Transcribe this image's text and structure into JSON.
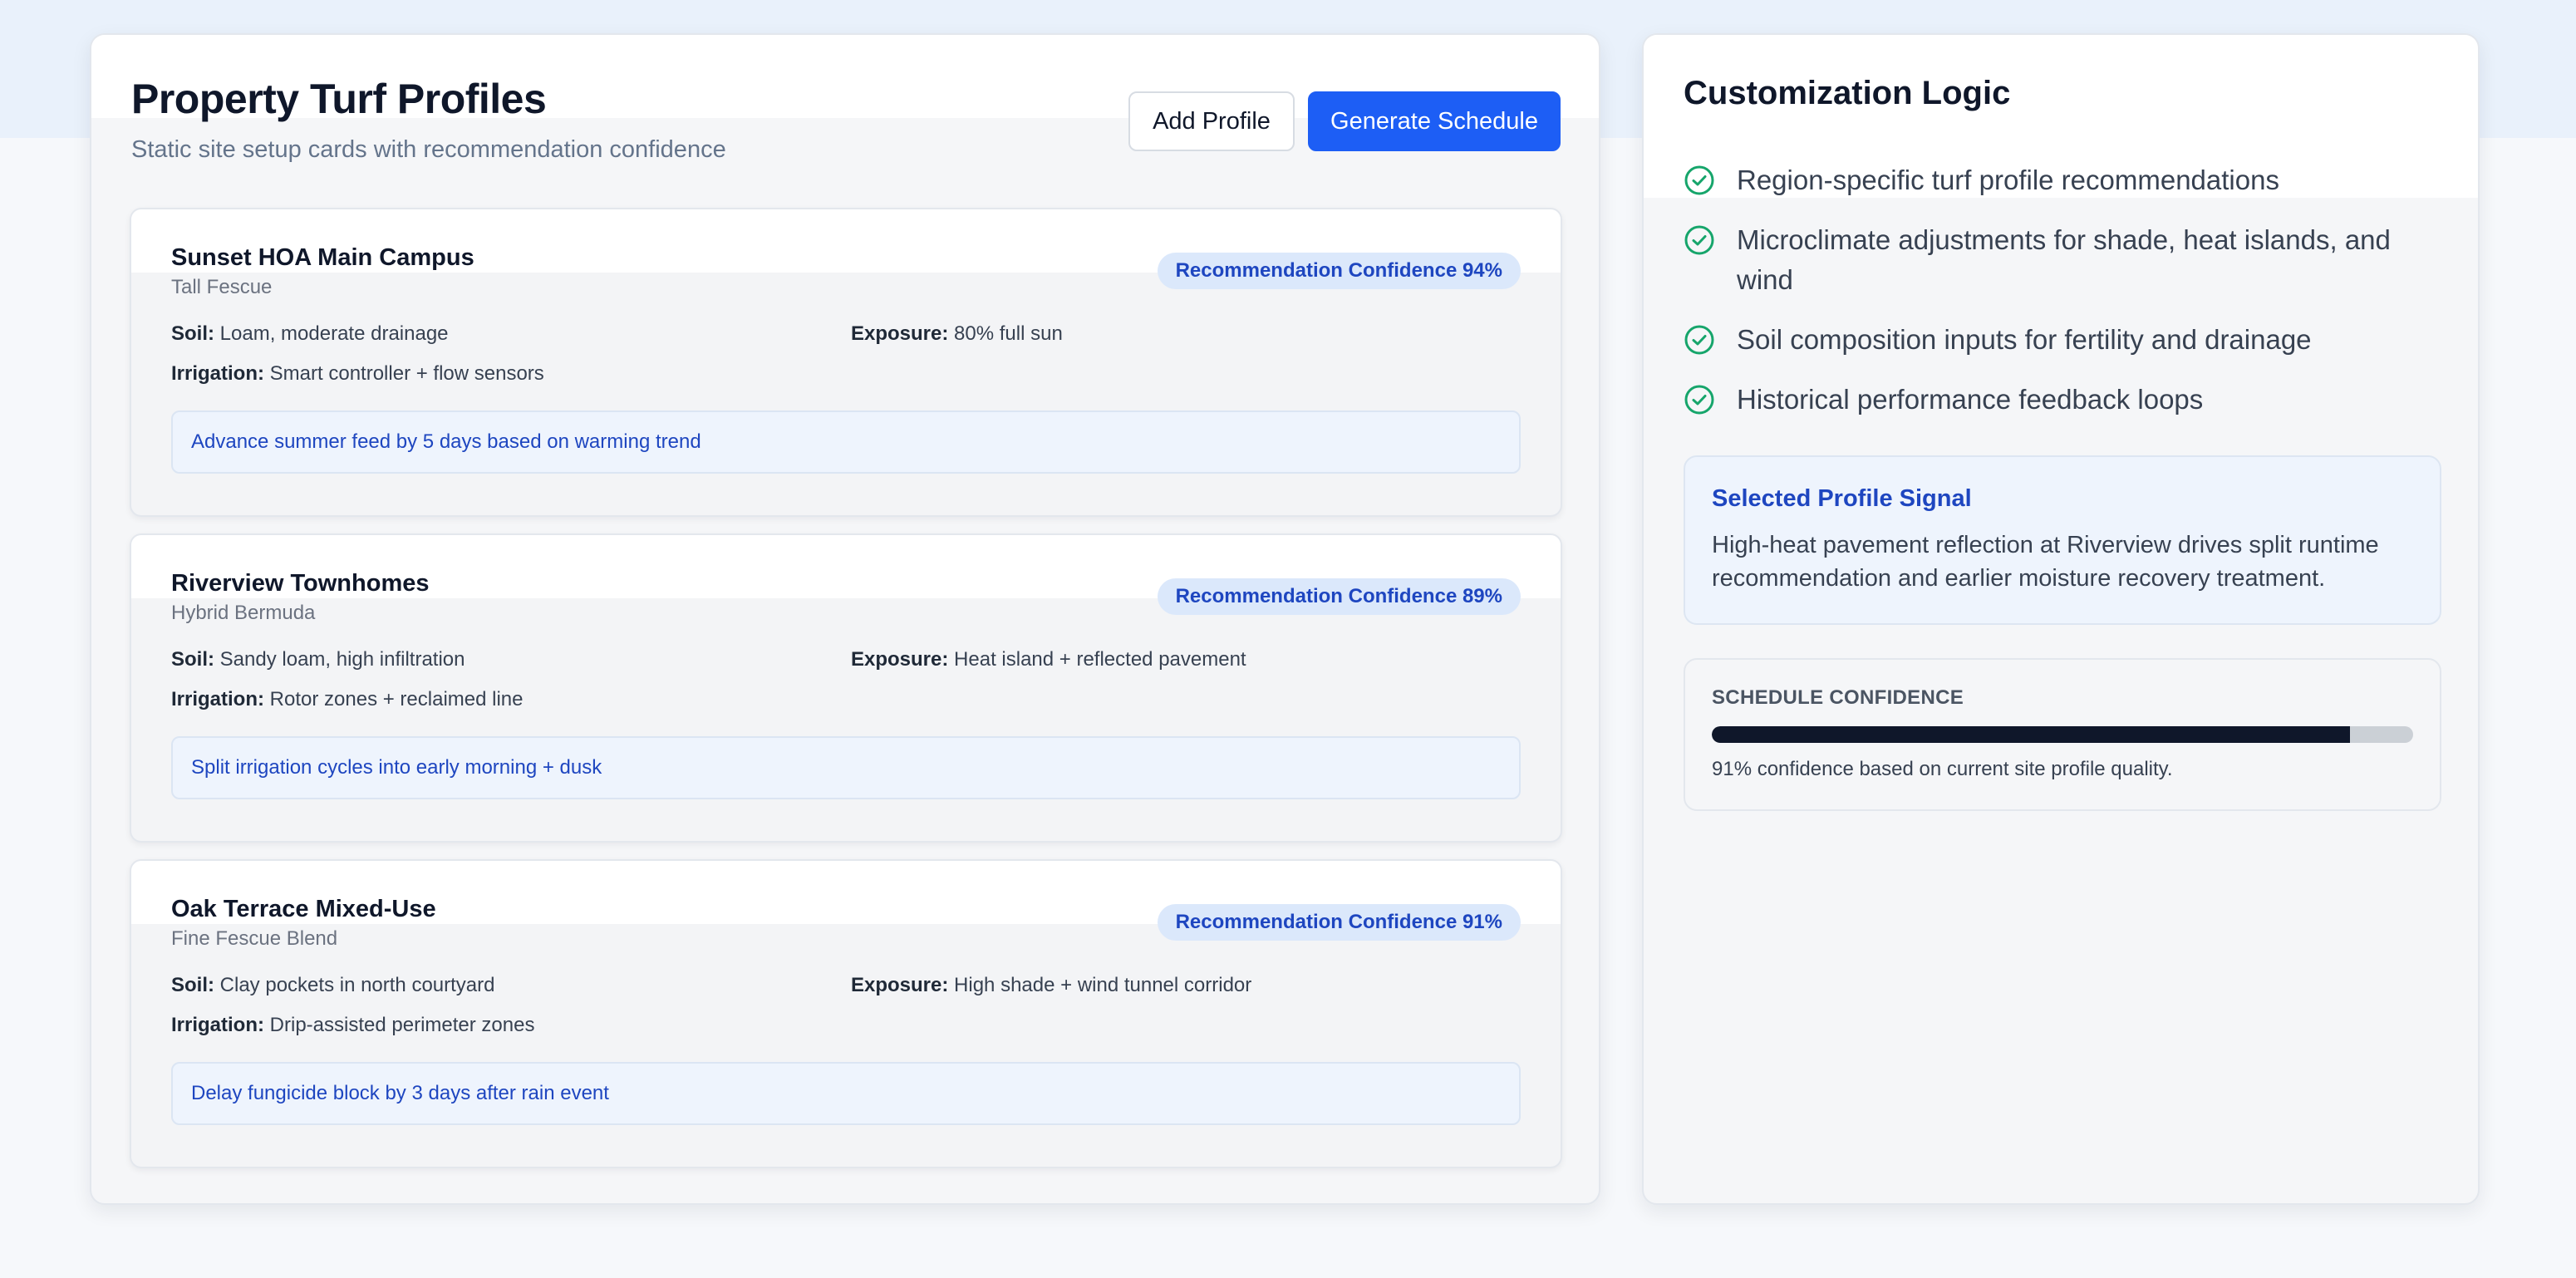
{
  "header": {
    "title": "Property Turf Profiles",
    "subtitle": "Static site setup cards with recommendation confidence",
    "add_profile_label": "Add Profile",
    "generate_schedule_label": "Generate Schedule"
  },
  "labels": {
    "soil": "Soil:",
    "exposure": "Exposure:",
    "irrigation": "Irrigation:"
  },
  "profiles": [
    {
      "name": "Sunset HOA Main Campus",
      "turf": "Tall Fescue",
      "confidence": "Recommendation Confidence 94%",
      "soil": "Loam, moderate drainage",
      "exposure": "80% full sun",
      "irrigation": "Smart controller + flow sensors",
      "recommendation": "Advance summer feed by 5 days based on warming trend"
    },
    {
      "name": "Riverview Townhomes",
      "turf": "Hybrid Bermuda",
      "confidence": "Recommendation Confidence 89%",
      "soil": "Sandy loam, high infiltration",
      "exposure": "Heat island + reflected pavement",
      "irrigation": "Rotor zones + reclaimed line",
      "recommendation": "Split irrigation cycles into early morning + dusk"
    },
    {
      "name": "Oak Terrace Mixed-Use",
      "turf": "Fine Fescue Blend",
      "confidence": "Recommendation Confidence 91%",
      "soil": "Clay pockets in north courtyard",
      "exposure": "High shade + wind tunnel corridor",
      "irrigation": "Drip-assisted perimeter zones",
      "recommendation": "Delay fungicide block by 3 days after rain event"
    }
  ],
  "logic": {
    "title": "Customization Logic",
    "items": [
      "Region-specific turf profile recommendations",
      "Microclimate adjustments for shade, heat islands, and wind",
      "Soil composition inputs for fertility and drainage",
      "Historical performance feedback loops"
    ],
    "icon": "check-circle-icon"
  },
  "signal": {
    "title": "Selected Profile Signal",
    "text": "High-heat pavement reflection at Riverview drives split runtime recommendation and earlier moisture recovery treatment."
  },
  "schedule": {
    "label": "SCHEDULE CONFIDENCE",
    "progress_percent": 91,
    "caption": "91% confidence based on current site profile quality."
  },
  "colors": {
    "accent": "#1d5ef5",
    "badge_bg": "#dbe8fb",
    "badge_text": "#1e46c0",
    "check": "#16a56b",
    "progress_fill": "#0f172a"
  }
}
